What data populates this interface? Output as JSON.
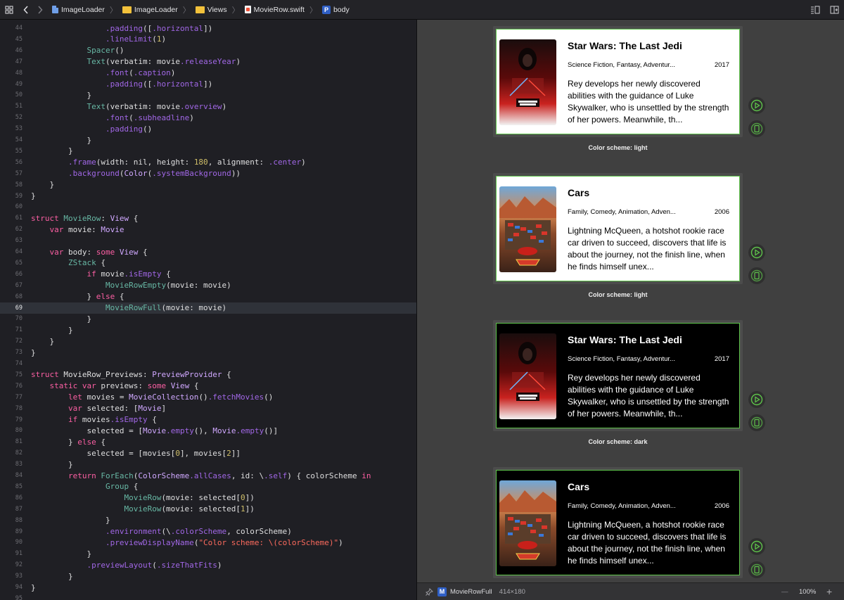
{
  "jumpbar": {
    "crumbs": [
      {
        "label": "ImageLoader",
        "icon": "project-file-icon"
      },
      {
        "label": "ImageLoader",
        "icon": "folder-icon"
      },
      {
        "label": "Views",
        "icon": "folder-icon"
      },
      {
        "label": "MovieRow.swift",
        "icon": "swift-file-icon"
      },
      {
        "label": "body",
        "icon": "property-icon",
        "badge": "P"
      }
    ]
  },
  "editor": {
    "active_line": "69",
    "lines": [
      {
        "n": "44",
        "code": "                .padding([.horizontal])"
      },
      {
        "n": "45",
        "code": "                .lineLimit(1)"
      },
      {
        "n": "46",
        "code": "            Spacer()"
      },
      {
        "n": "47",
        "code": "            Text(verbatim: movie.releaseYear)"
      },
      {
        "n": "48",
        "code": "                .font(.caption)"
      },
      {
        "n": "49",
        "code": "                .padding([.horizontal])"
      },
      {
        "n": "50",
        "code": "            }"
      },
      {
        "n": "51",
        "code": "            Text(verbatim: movie.overview)"
      },
      {
        "n": "52",
        "code": "                .font(.subheadline)"
      },
      {
        "n": "53",
        "code": "                .padding()"
      },
      {
        "n": "54",
        "code": "            }"
      },
      {
        "n": "55",
        "code": "        }"
      },
      {
        "n": "56",
        "code": "        .frame(width: nil, height: 180, alignment: .center)"
      },
      {
        "n": "57",
        "code": "        .background(Color(.systemBackground))"
      },
      {
        "n": "58",
        "code": "    }"
      },
      {
        "n": "59",
        "code": "}"
      },
      {
        "n": "60",
        "code": ""
      },
      {
        "n": "61",
        "code": "struct MovieRow: View {"
      },
      {
        "n": "62",
        "code": "    var movie: Movie"
      },
      {
        "n": "63",
        "code": ""
      },
      {
        "n": "64",
        "code": "    var body: some View {"
      },
      {
        "n": "65",
        "code": "        ZStack {"
      },
      {
        "n": "66",
        "code": "            if movie.isEmpty {"
      },
      {
        "n": "67",
        "code": "                MovieRowEmpty(movie: movie)"
      },
      {
        "n": "68",
        "code": "            } else {"
      },
      {
        "n": "69",
        "code": "                MovieRowFull(movie: movie)"
      },
      {
        "n": "70",
        "code": "            }"
      },
      {
        "n": "71",
        "code": "        }"
      },
      {
        "n": "72",
        "code": "    }"
      },
      {
        "n": "73",
        "code": "}"
      },
      {
        "n": "74",
        "code": ""
      },
      {
        "n": "75",
        "code": "struct MovieRow_Previews: PreviewProvider {"
      },
      {
        "n": "76",
        "code": "    static var previews: some View {"
      },
      {
        "n": "77",
        "code": "        let movies = MovieCollection().fetchMovies()"
      },
      {
        "n": "78",
        "code": "        var selected: [Movie]"
      },
      {
        "n": "79",
        "code": "        if movies.isEmpty {"
      },
      {
        "n": "80",
        "code": "            selected = [Movie.empty(), Movie.empty()]"
      },
      {
        "n": "81",
        "code": "        } else {"
      },
      {
        "n": "82",
        "code": "            selected = [movies[0], movies[2]]"
      },
      {
        "n": "83",
        "code": "        }"
      },
      {
        "n": "84",
        "code": "        return ForEach(ColorScheme.allCases, id: \\.self) { colorScheme in"
      },
      {
        "n": "85",
        "code": "                Group {"
      },
      {
        "n": "86",
        "code": "                    MovieRow(movie: selected[0])"
      },
      {
        "n": "87",
        "code": "                    MovieRow(movie: selected[1])"
      },
      {
        "n": "88",
        "code": "                }"
      },
      {
        "n": "89",
        "code": "                .environment(\\.colorScheme, colorScheme)"
      },
      {
        "n": "90",
        "code": "                .previewDisplayName(\"Color scheme: \\(colorScheme)\")"
      },
      {
        "n": "91",
        "code": "            }"
      },
      {
        "n": "92",
        "code": "            .previewLayout(.sizeThatFits)"
      },
      {
        "n": "93",
        "code": "        }"
      },
      {
        "n": "94",
        "code": "}"
      },
      {
        "n": "95",
        "code": ""
      }
    ]
  },
  "previews": [
    {
      "scheme": "light",
      "title": "Star Wars: The Last Jedi",
      "genres": "Science Fiction, Fantasy, Adventur...",
      "year": "2017",
      "overview": "Rey develops her newly discovered abilities with the guidance of Luke Skywalker, who is unsettled by the strength of her powers. Meanwhile, th...",
      "caption": "Color scheme: light",
      "poster": "star-wars-poster"
    },
    {
      "scheme": "light",
      "title": "Cars",
      "genres": "Family, Comedy, Animation, Adven...",
      "year": "2006",
      "overview": "Lightning McQueen, a hotshot rookie race car driven to succeed, discovers that life is about the journey, not the finish line, when he finds himself unex...",
      "caption": "Color scheme: light",
      "poster": "cars-poster"
    },
    {
      "scheme": "dark",
      "title": "Star Wars: The Last Jedi",
      "genres": "Science Fiction, Fantasy, Adventur...",
      "year": "2017",
      "overview": "Rey develops her newly discovered abilities with the guidance of Luke Skywalker, who is unsettled by the strength of her powers. Meanwhile, th...",
      "caption": "Color scheme: dark",
      "poster": "star-wars-poster"
    },
    {
      "scheme": "dark",
      "title": "Cars",
      "genres": "Family, Comedy, Animation, Adven...",
      "year": "2006",
      "overview": "Lightning McQueen, a hotshot rookie race car driven to succeed, discovers that life is about the journey, not the finish line, when he finds himself unex...",
      "caption": "",
      "poster": "cars-poster"
    }
  ],
  "bottombar": {
    "badge": "M",
    "view_name": "MovieRowFull",
    "size": "414×180",
    "zoom": "100%",
    "zoom_out": "—",
    "zoom_in": "+"
  },
  "colors": {
    "editor_bg": "#1f1f24",
    "canvas_bg": "#404040",
    "preview_border": "#5ec44a",
    "keyword": "#fc5fa3",
    "type": "#d0a8ff",
    "member": "#a167e6",
    "number": "#d0bf69",
    "string": "#fc6a5d"
  }
}
